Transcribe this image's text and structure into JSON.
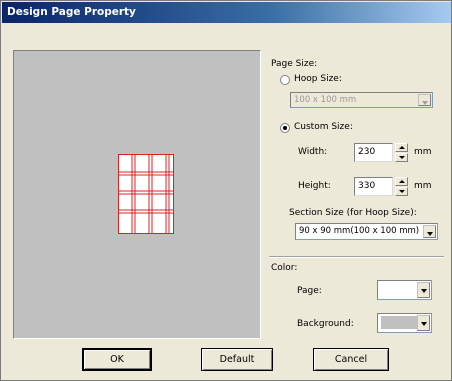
{
  "window": {
    "title": "Design Page Property"
  },
  "page_size": {
    "heading": "Page Size:",
    "hoop_size": {
      "label": "Hoop Size:",
      "selected": false,
      "value": "100 x 100 mm",
      "enabled": false
    },
    "custom_size": {
      "label": "Custom Size:",
      "selected": true
    },
    "width": {
      "label": "Width:",
      "value": "230",
      "unit": "mm"
    },
    "height": {
      "label": "Height:",
      "value": "330",
      "unit": "mm"
    },
    "section_size": {
      "label": "Section Size (for Hoop Size):",
      "value": "90 x  90 mm(100 x 100 mm)"
    }
  },
  "color": {
    "heading": "Color:",
    "page": {
      "label": "Page:",
      "color": "#ffffff"
    },
    "background": {
      "label": "Background:",
      "color": "#c0c0c0"
    }
  },
  "buttons": {
    "ok": "OK",
    "default": "Default",
    "cancel": "Cancel"
  },
  "preview": {
    "background_color": "#c0c0c0",
    "page_fill": "#ffffff",
    "grid_color": "#e02020",
    "grid_columns": 4,
    "grid_rows": 4
  }
}
